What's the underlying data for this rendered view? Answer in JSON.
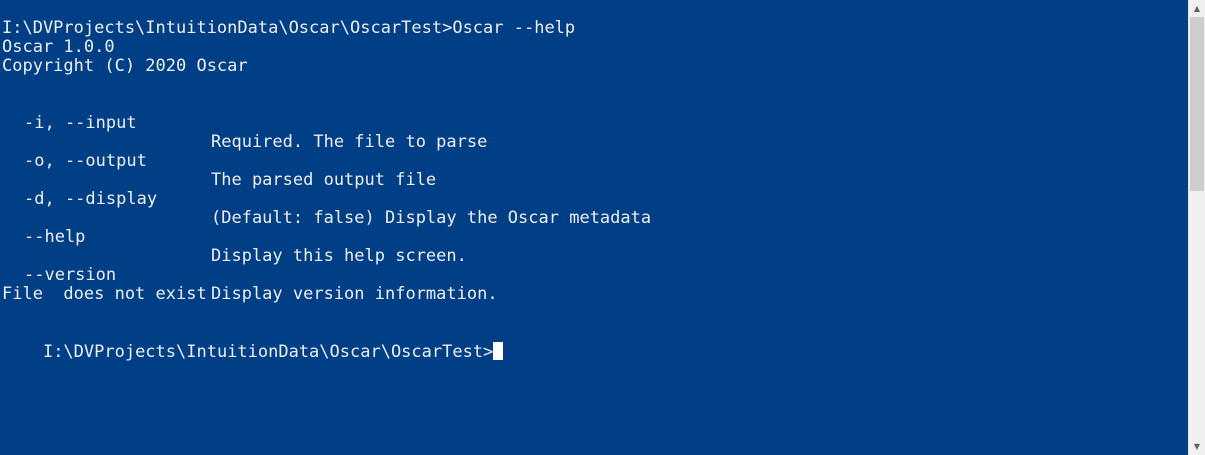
{
  "console": {
    "command_line": "I:\\DVProjects\\IntuitionData\\Oscar\\OscarTest>Oscar --help",
    "version_line": "Oscar 1.0.0",
    "copyright_line": "Copyright (C) 2020 Oscar",
    "options": [
      {
        "flag": "-i, --input",
        "description": "Required. The file to parse"
      },
      {
        "flag": "-o, --output",
        "description": "The parsed output file"
      },
      {
        "flag": "-d, --display",
        "description": "(Default: false) Display the Oscar metadata"
      },
      {
        "flag": "--help",
        "description": "Display this help screen."
      },
      {
        "flag": "--version",
        "description": "Display version information."
      }
    ],
    "error_line": "File  does not exist",
    "prompt": "I:\\DVProjects\\IntuitionData\\Oscar\\OscarTest>"
  },
  "scrollbar": {
    "up_icon": "triangle-up-icon",
    "down_icon": "triangle-down-icon"
  },
  "colors": {
    "background": "#003f86",
    "text": "#eeeeee",
    "scrollbar_track": "#f0f0f0",
    "scrollbar_thumb": "#cdcdcd"
  }
}
